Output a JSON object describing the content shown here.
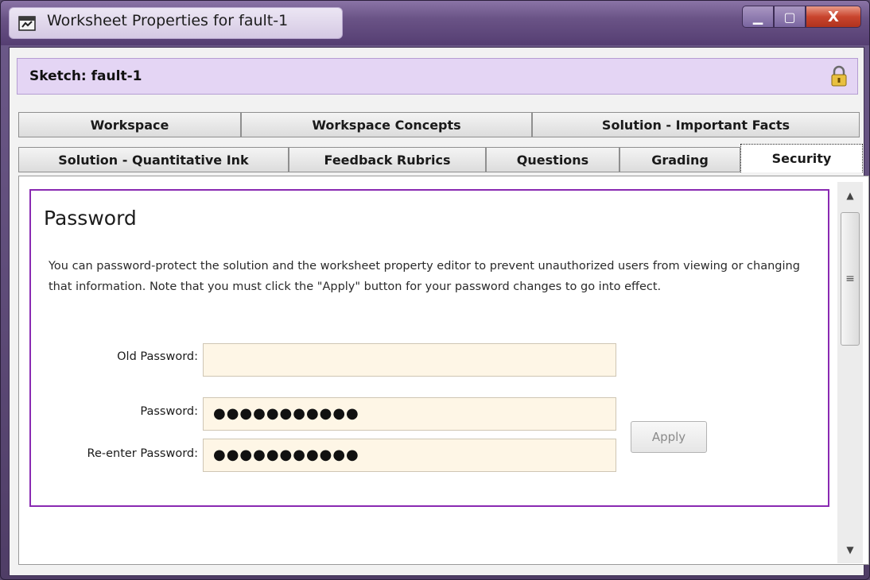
{
  "window": {
    "title": "Worksheet Properties for fault-1",
    "minimize_glyph": "▁",
    "maximize_glyph": "▢",
    "close_glyph": "X"
  },
  "sketch": {
    "label": "Sketch: fault-1"
  },
  "tabs_row1": [
    {
      "label": "Workspace"
    },
    {
      "label": "Workspace Concepts"
    },
    {
      "label": "Solution - Important Facts"
    }
  ],
  "tabs_row2": [
    {
      "label": "Solution - Quantitative Ink"
    },
    {
      "label": "Feedback Rubrics"
    },
    {
      "label": "Questions"
    },
    {
      "label": "Grading"
    },
    {
      "label": "Security",
      "active": true
    }
  ],
  "security": {
    "heading": "Password",
    "description": "You can password-protect the solution and the worksheet property editor to prevent unauthorized users from viewing or changing that information.  Note that you must click the \"Apply\" button for your password changes to go into effect.",
    "old_password_label": "Old Password:",
    "old_password_value": "",
    "password_label": "Password:",
    "password_value": "●●●●●●●●●●●",
    "reenter_label": "Re-enter Password:",
    "reenter_value": "●●●●●●●●●●●",
    "apply_label": "Apply"
  },
  "scrollbar": {
    "up_glyph": "▲",
    "down_glyph": "▼",
    "grip_glyph": "≡"
  },
  "icons": {
    "app": "worksheet-app-icon",
    "lock": "lock-icon"
  },
  "colors": {
    "accent_border": "#8a2ab2",
    "sketch_bar": "#e4d5f4",
    "field_bg": "#fef6e6",
    "title_bar": "#6a5386"
  }
}
